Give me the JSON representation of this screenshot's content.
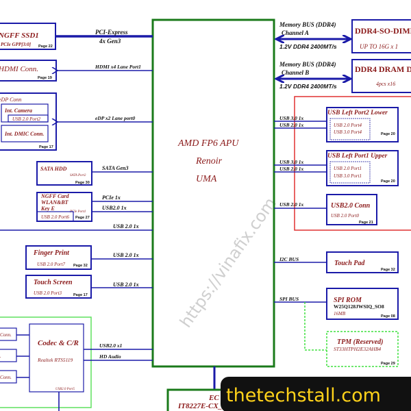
{
  "apu": {
    "title": "AMD FP6 APU",
    "line2": "Renoir",
    "line3": "UMA"
  },
  "left": {
    "ssd": {
      "title": "NGFF   SSD1",
      "sub": "PCIe GPP[3:0]",
      "page": "Page 22",
      "bus1": "PCI-Express",
      "bus2": "4x Gen3"
    },
    "hdmi": {
      "title": "HDMI Conn.",
      "page": "Page 19",
      "bus": "HDMI x4 Lane Port1"
    },
    "edp": {
      "title": "eDP Conn",
      "camera": "Int. Camera",
      "camera_port": "USB 2.0 Port2",
      "dmic": "Int. DMIC Conn.",
      "page": "Page 17",
      "bus": "eDP x2 Lane port0"
    },
    "sata": {
      "title": "SATA HDD",
      "sub": "SATA Port2",
      "page": "Page 30",
      "bus": "SATA Gen3"
    },
    "wlan": {
      "title1": "NGFF Card",
      "title2": "WLAN&BT",
      "title3": "Key E",
      "pcie_port": "PCIe Port4",
      "usb_port": "USB 2.0 Port6",
      "page": "Page 27",
      "bus1": "PCIe 1x",
      "bus2": "USB2.0 1x"
    },
    "usb_line": {
      "bus": "USB 2.0 1x"
    },
    "finger": {
      "title": "Finger Print",
      "sub": "USB 2.0 Port7",
      "page": "Page 32",
      "bus": "USB 2.0 1x"
    },
    "touchscreen": {
      "title": "Touch Screen",
      "sub": "USB 2.0 Port3",
      "page": "Page 17",
      "bus": "USB 2.0 1x"
    },
    "codec": {
      "title": "Codec & C/R",
      "chip": "Realtek RTS5119",
      "port": "USB2.0 Port5",
      "bus1": "USB2.0 x1",
      "bus2": "HD Audio",
      "conns": [
        "Conn.",
        ".",
        "Conn."
      ]
    }
  },
  "right": {
    "memA": {
      "bus": "Memory BUS (DDR4)",
      "channel": "Channel A",
      "speed": "1.2V DDR4 2400MT/s",
      "title": "DDR4-SO-DIMM",
      "sub": "UP TO 16G x 1"
    },
    "memB": {
      "bus": "Memory BUS (DDR4)",
      "channel": "Channel B",
      "speed": "1.2V DDR4 2400MT/s",
      "title": "DDR4 DRAM D",
      "sub": "4pcs x16"
    },
    "usb_p2": {
      "title": "USB Left Port2 Lower",
      "p1": "USB 2.0 Port4",
      "p2": "USB 3.0 Port4",
      "page": "Page 20",
      "bus1": "USB 3.0 1x",
      "bus2": "USB 2.0 1x"
    },
    "usb_p1": {
      "title": "USB Left Port1 Upper",
      "p1": "USB 2.0 Port1",
      "p2": "USB 3.0 Port1",
      "page": "Page 20",
      "bus1": "USB 3.0 1x",
      "bus2": "USB 2.0 1x"
    },
    "usb_conn": {
      "title": "USB2.0 Conn",
      "sub": "USB 2.0 Port0",
      "page": "Page 21",
      "bus": "USB 2.0 1x"
    },
    "touchpad": {
      "title": "Touch Pad",
      "page": "Page 32",
      "bus": "I2C BUS"
    },
    "spirom": {
      "title": "SPI ROM",
      "chip": "W25Q128JWSIQ_SO8",
      "size": "16MB",
      "page": "Page 08",
      "bus": "SPI BUS"
    },
    "tpm": {
      "title": "TPM (Reserved)",
      "chip": "ST33HTPH2E32AHB4",
      "page": "Page 29"
    }
  },
  "ec": {
    "title": "EC",
    "chip": "IT8227E-CX_"
  },
  "watermarks": {
    "diagonal": "https://vinafix.com",
    "badge": "thetechstall.com"
  },
  "colors": {
    "apu_border": "#1a7a1a",
    "wire": "#1a1aa8",
    "title_text": "#8b1a1a",
    "usb_group": "#e03030",
    "audio_group": "#5ee05e",
    "badge_bg": "#111111",
    "badge_text": "#ffd21a"
  }
}
